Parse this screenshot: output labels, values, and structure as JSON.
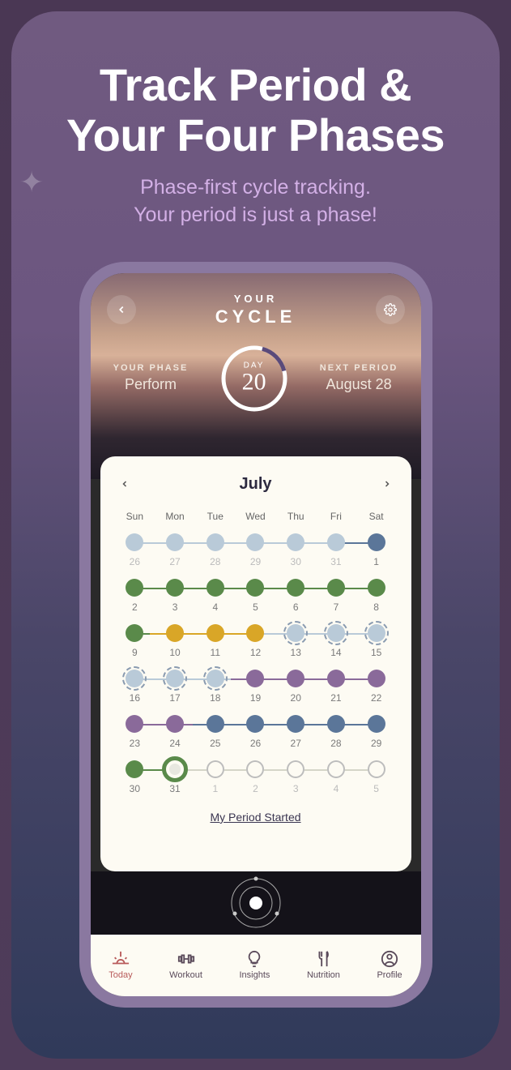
{
  "promo": {
    "headline_l1": "Track Period &",
    "headline_l2": "Your Four Phases",
    "sub_l1": "Phase-first cycle tracking.",
    "sub_l2": "Your period is just a phase!"
  },
  "header": {
    "pre_title": "YOUR",
    "title": "CYCLE",
    "phase_label": "YOUR PHASE",
    "phase_value": "Perform",
    "day_label": "DAY",
    "day_value": "20",
    "next_label": "NEXT PERIOD",
    "next_value": "August 28"
  },
  "calendar": {
    "month": "July",
    "dow": [
      "Sun",
      "Mon",
      "Tue",
      "Wed",
      "Thu",
      "Fri",
      "Sat"
    ],
    "period_link": "My Period Started",
    "rows": [
      {
        "line": "line-lblue",
        "cells": [
          {
            "n": "26",
            "out": true,
            "color": "lblue"
          },
          {
            "n": "27",
            "out": true,
            "color": "lblue"
          },
          {
            "n": "28",
            "out": true,
            "color": "lblue"
          },
          {
            "n": "29",
            "out": true,
            "color": "lblue"
          },
          {
            "n": "30",
            "out": true,
            "color": "lblue"
          },
          {
            "n": "31",
            "out": true,
            "color": "lblue"
          },
          {
            "n": "1",
            "color": "blue"
          }
        ]
      },
      {
        "line": "line-green",
        "cells": [
          {
            "n": "2",
            "color": "green"
          },
          {
            "n": "3",
            "color": "green"
          },
          {
            "n": "4",
            "color": "green"
          },
          {
            "n": "5",
            "color": "green"
          },
          {
            "n": "6",
            "color": "green"
          },
          {
            "n": "7",
            "color": "green"
          },
          {
            "n": "8",
            "color": "green"
          }
        ]
      },
      {
        "line": "line-gold-mix",
        "cells": [
          {
            "n": "9",
            "color": "green"
          },
          {
            "n": "10",
            "color": "gold"
          },
          {
            "n": "11",
            "color": "gold"
          },
          {
            "n": "12",
            "color": "gold"
          },
          {
            "n": "13",
            "color": "lblue",
            "dash": true
          },
          {
            "n": "14",
            "color": "lblue",
            "dash": true
          },
          {
            "n": "15",
            "color": "lblue",
            "dash": true
          }
        ]
      },
      {
        "line": "line-lblue-purple",
        "cells": [
          {
            "n": "16",
            "color": "lblue",
            "dash": true
          },
          {
            "n": "17",
            "color": "lblue",
            "dash": true
          },
          {
            "n": "18",
            "color": "lblue",
            "dash": true
          },
          {
            "n": "19",
            "color": "purple"
          },
          {
            "n": "20",
            "color": "purple"
          },
          {
            "n": "21",
            "color": "purple"
          },
          {
            "n": "22",
            "color": "purple"
          }
        ]
      },
      {
        "line": "line-purple-blue",
        "cells": [
          {
            "n": "23",
            "color": "purple"
          },
          {
            "n": "24",
            "color": "purple"
          },
          {
            "n": "25",
            "color": "blue"
          },
          {
            "n": "26",
            "color": "blue"
          },
          {
            "n": "27",
            "color": "blue"
          },
          {
            "n": "28",
            "color": "blue"
          },
          {
            "n": "29",
            "color": "blue"
          }
        ]
      },
      {
        "line": "line-green2",
        "cells": [
          {
            "n": "30",
            "color": "green"
          },
          {
            "n": "31",
            "today": true
          },
          {
            "n": "1",
            "out": true,
            "outline": true
          },
          {
            "n": "2",
            "out": true,
            "outline": true
          },
          {
            "n": "3",
            "out": true,
            "outline": true
          },
          {
            "n": "4",
            "out": true,
            "outline": true
          },
          {
            "n": "5",
            "out": true,
            "outline": true
          }
        ]
      }
    ]
  },
  "nav": {
    "items": [
      {
        "label": "Today",
        "icon": "sunrise",
        "active": true
      },
      {
        "label": "Workout",
        "icon": "dumbbell"
      },
      {
        "label": "Insights",
        "icon": "bulb"
      },
      {
        "label": "Nutrition",
        "icon": "fork"
      },
      {
        "label": "Profile",
        "icon": "user"
      }
    ]
  }
}
